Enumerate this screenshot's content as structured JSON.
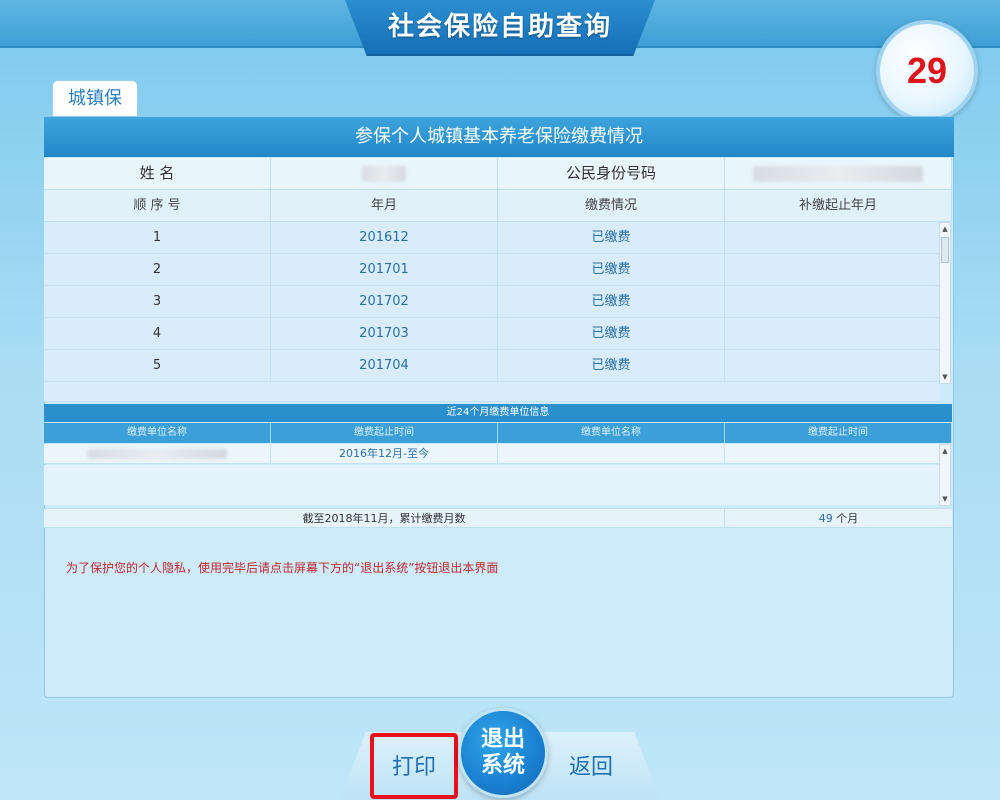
{
  "header": {
    "title": "社会保险自助查询"
  },
  "countdown": {
    "value": "29"
  },
  "tabs": [
    {
      "label": "城镇保"
    }
  ],
  "panel": {
    "title": "参保个人城镇基本养老保险缴费情况"
  },
  "info": {
    "name_label": "姓 名",
    "id_label": "公民身份号码"
  },
  "table": {
    "headers": [
      "顺 序 号",
      "年月",
      "缴费情况",
      "补缴起止年月"
    ],
    "rows": [
      {
        "seq": "1",
        "month": "201612",
        "status": "已缴费",
        "supplement": ""
      },
      {
        "seq": "2",
        "month": "201701",
        "status": "已缴费",
        "supplement": ""
      },
      {
        "seq": "3",
        "month": "201702",
        "status": "已缴费",
        "supplement": ""
      },
      {
        "seq": "4",
        "month": "201703",
        "status": "已缴费",
        "supplement": ""
      },
      {
        "seq": "5",
        "month": "201704",
        "status": "已缴费",
        "supplement": ""
      }
    ]
  },
  "units": {
    "title": "近24个月缴费单位信息",
    "headers": [
      "缴费单位名称",
      "缴费起止时间",
      "缴费单位名称",
      "缴费起止时间"
    ],
    "rows": [
      {
        "period": "2016年12月-至今"
      }
    ]
  },
  "total": {
    "label": "截至2018年11月，累计缴费月数",
    "count": "49",
    "unit": "个月"
  },
  "privacy_notice": "为了保护您的个人隐私，使用完毕后请点击屏幕下方的“退出系统”按钮退出本界面",
  "buttons": {
    "print": "打印",
    "exit_line1": "退出",
    "exit_line2": "系统",
    "back": "返回"
  }
}
